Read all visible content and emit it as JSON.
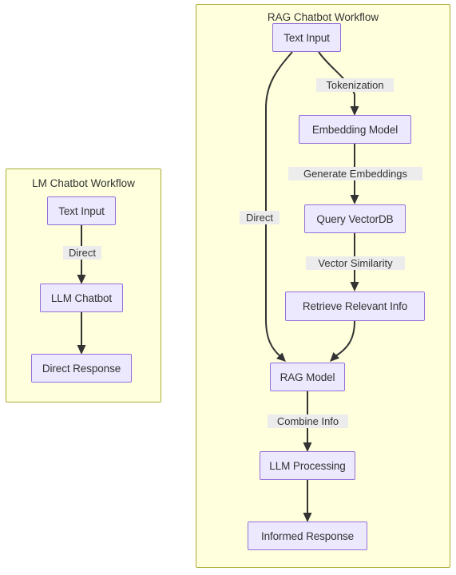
{
  "diagram": {
    "type": "flowchart",
    "direction": "top-down",
    "colors": {
      "subgraph_fill": "#ffffde",
      "subgraph_stroke": "#aaaa33",
      "node_fill": "#ece8fd",
      "node_stroke": "#9370db",
      "edge_stroke": "#333333",
      "edge_label_bg": "#ececec",
      "text": "#333333",
      "page_bg": "#ffffff"
    },
    "subgraphs": [
      {
        "id": "lm",
        "title": "LM Chatbot Workflow",
        "nodes": [
          {
            "id": "lm-text-input",
            "label": "Text Input"
          },
          {
            "id": "lm-llm-chatbot",
            "label": "LLM Chatbot"
          },
          {
            "id": "lm-direct-response",
            "label": "Direct Response"
          }
        ],
        "edges": [
          {
            "from": "lm-text-input",
            "to": "lm-llm-chatbot",
            "label": "Direct"
          },
          {
            "from": "lm-llm-chatbot",
            "to": "lm-direct-response",
            "label": ""
          }
        ]
      },
      {
        "id": "rag",
        "title": "RAG Chatbot Workflow",
        "nodes": [
          {
            "id": "rag-text-input",
            "label": "Text Input"
          },
          {
            "id": "rag-embedding-model",
            "label": "Embedding Model"
          },
          {
            "id": "rag-query-vectordb",
            "label": "Query VectorDB"
          },
          {
            "id": "rag-retrieve-relevant-info",
            "label": "Retrieve Relevant Info"
          },
          {
            "id": "rag-rag-model",
            "label": "RAG Model"
          },
          {
            "id": "rag-llm-processing",
            "label": "LLM Processing"
          },
          {
            "id": "rag-informed-response",
            "label": "Informed Response"
          }
        ],
        "edges": [
          {
            "from": "rag-text-input",
            "to": "rag-embedding-model",
            "label": "Tokenization"
          },
          {
            "from": "rag-text-input",
            "to": "rag-rag-model",
            "label": "Direct"
          },
          {
            "from": "rag-embedding-model",
            "to": "rag-query-vectordb",
            "label": "Generate Embeddings"
          },
          {
            "from": "rag-query-vectordb",
            "to": "rag-retrieve-relevant-info",
            "label": "Vector Similarity"
          },
          {
            "from": "rag-retrieve-relevant-info",
            "to": "rag-rag-model",
            "label": ""
          },
          {
            "from": "rag-rag-model",
            "to": "rag-llm-processing",
            "label": "Combine Info"
          },
          {
            "from": "rag-llm-processing",
            "to": "rag-informed-response",
            "label": ""
          }
        ]
      }
    ]
  }
}
